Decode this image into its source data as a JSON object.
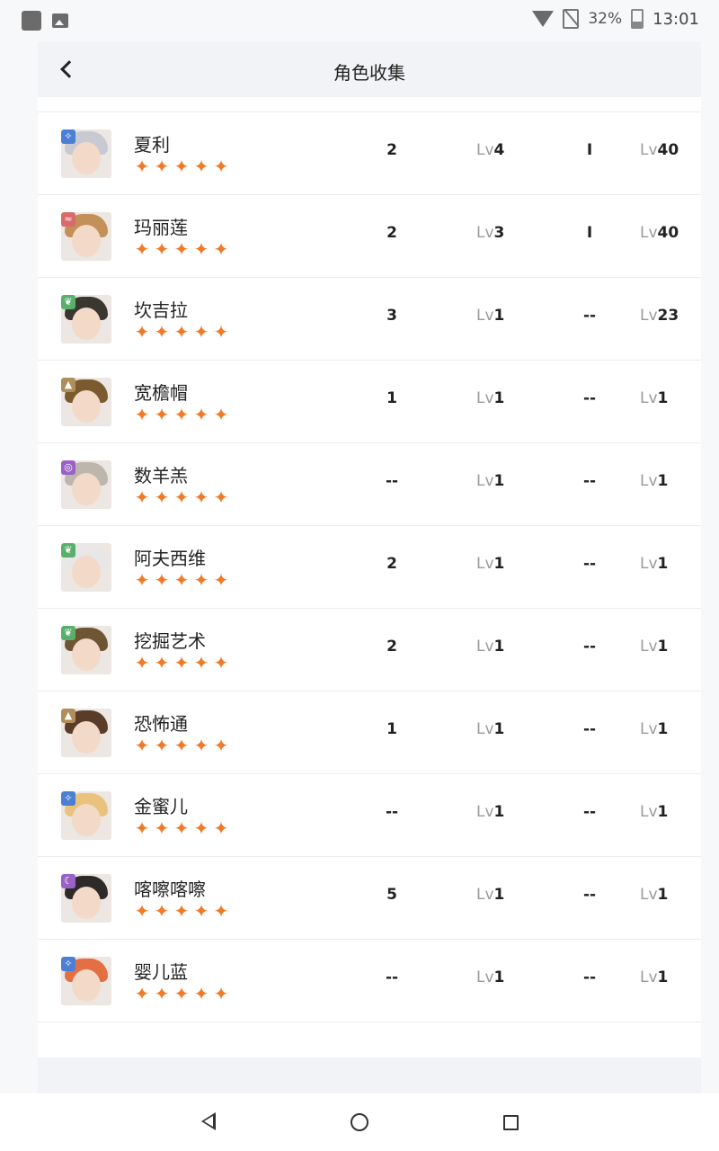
{
  "status_bar": {
    "battery": "32%",
    "time": "13:01",
    "icons": [
      "app-icon",
      "gallery-icon",
      "wifi-icon",
      "no-sim-icon",
      "battery-icon"
    ]
  },
  "header": {
    "title": "角色收集",
    "back_icon": "chevron-left-icon"
  },
  "star_glyph": "✦",
  "lv_prefix": "Lv",
  "characters": [
    {
      "name": "夏利",
      "element": "star-element",
      "badge_color": "#4a7fd3",
      "badge": "✧",
      "hair": "#c9c9d2",
      "stars": 5,
      "count": "2",
      "level": "4",
      "rank": "I",
      "level2": "40"
    },
    {
      "name": "玛丽莲",
      "element": "beast-element",
      "badge_color": "#d96a6a",
      "badge": "≈",
      "hair": "#c49059",
      "stars": 5,
      "count": "2",
      "level": "3",
      "rank": "I",
      "level2": "40"
    },
    {
      "name": "坎吉拉",
      "element": "plant-element",
      "badge_color": "#58b06b",
      "badge": "❦",
      "hair": "#3a3730",
      "stars": 5,
      "count": "3",
      "level": "1",
      "rank": "--",
      "level2": "23"
    },
    {
      "name": "宽檐帽",
      "element": "mineral-element",
      "badge_color": "#b08d5a",
      "badge": "▲",
      "hair": "#7a5a2e",
      "stars": 5,
      "count": "1",
      "level": "1",
      "rank": "--",
      "level2": "1"
    },
    {
      "name": "数羊羔",
      "element": "spirit-element",
      "badge_color": "#9a62c7",
      "badge": "◎",
      "hair": "#bdb6ac",
      "stars": 5,
      "count": "--",
      "level": "1",
      "rank": "--",
      "level2": "1"
    },
    {
      "name": "阿夫西维",
      "element": "plant-element",
      "badge_color": "#58b06b",
      "badge": "❦",
      "hair": "#e7e7e7",
      "stars": 5,
      "count": "2",
      "level": "1",
      "rank": "--",
      "level2": "1"
    },
    {
      "name": "挖掘艺术",
      "element": "plant-element",
      "badge_color": "#58b06b",
      "badge": "❦",
      "hair": "#6e5533",
      "stars": 5,
      "count": "2",
      "level": "1",
      "rank": "--",
      "level2": "1"
    },
    {
      "name": "恐怖通",
      "element": "mineral-element",
      "badge_color": "#b08d5a",
      "badge": "▲",
      "hair": "#5a3d28",
      "stars": 5,
      "count": "1",
      "level": "1",
      "rank": "--",
      "level2": "1"
    },
    {
      "name": "金蜜儿",
      "element": "star-element",
      "badge_color": "#4a7fd3",
      "badge": "✧",
      "hair": "#e9c27d",
      "stars": 5,
      "count": "--",
      "level": "1",
      "rank": "--",
      "level2": "1"
    },
    {
      "name": "喀嚓喀嚓",
      "element": "intellect-element",
      "badge_color": "#9a62c7",
      "badge": "☾",
      "hair": "#2f2a2a",
      "stars": 5,
      "count": "5",
      "level": "1",
      "rank": "--",
      "level2": "1"
    },
    {
      "name": "婴儿蓝",
      "element": "star-element",
      "badge_color": "#4a7fd3",
      "badge": "✧",
      "hair": "#e36f42",
      "stars": 5,
      "count": "--",
      "level": "1",
      "rank": "--",
      "level2": "1"
    }
  ],
  "nav_bar": {
    "icons": [
      "back-triangle-icon",
      "home-circle-icon",
      "recents-square-icon"
    ]
  }
}
